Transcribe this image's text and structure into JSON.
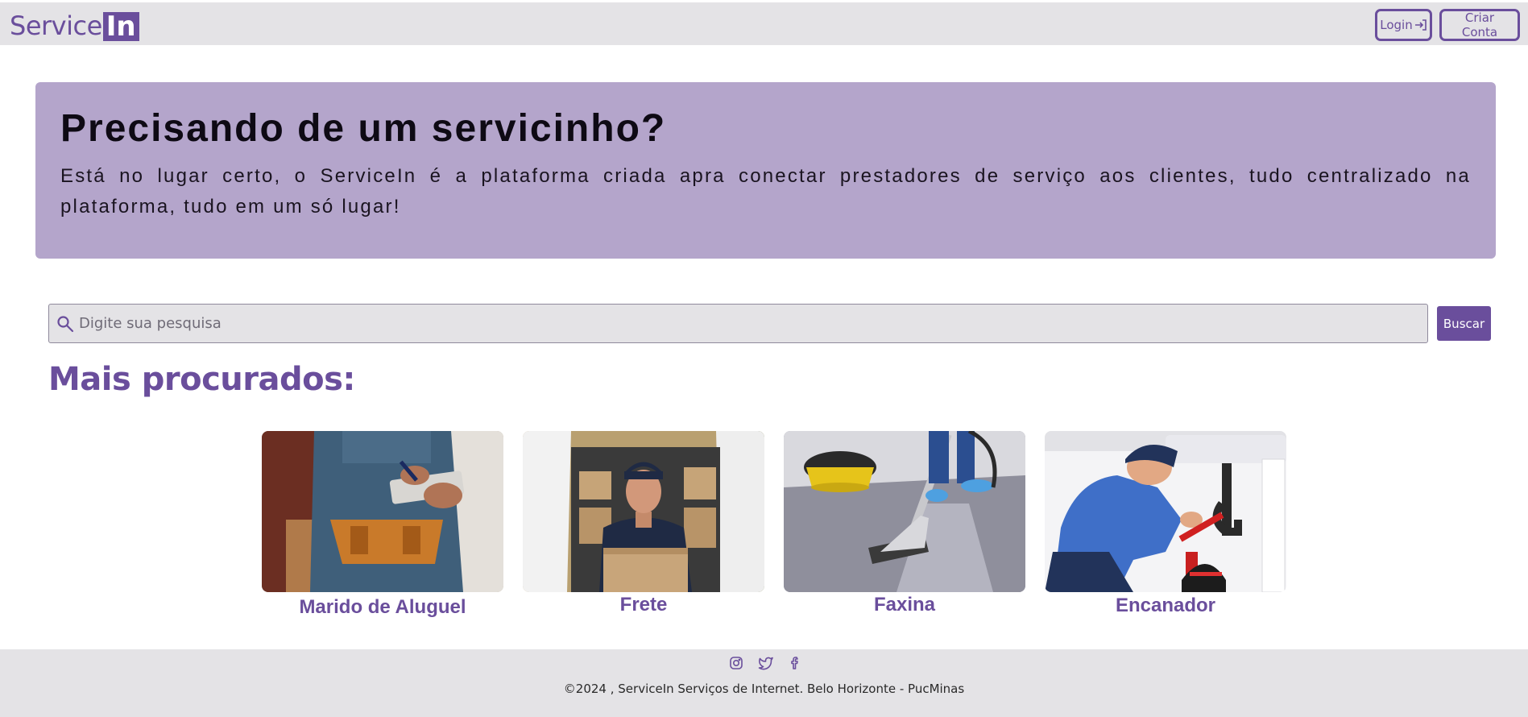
{
  "navbar": {
    "brand_text": "Service",
    "brand_box": "In",
    "login_label": "Login",
    "signup_label": "Criar Conta"
  },
  "hero": {
    "title": "Precisando de um servicinho?",
    "text": "Está no lugar certo, o ServiceIn é a plataforma criada apra conectar prestadores de serviço aos clientes, tudo centralizado na plataforma, tudo em um só lugar!"
  },
  "search": {
    "placeholder": "Digite sua pesquisa",
    "button_label": "Buscar"
  },
  "most_searched": {
    "title": "Mais procurados:",
    "items": [
      {
        "label": "Marido de Aluguel",
        "image": "handyman-photo"
      },
      {
        "label": "Frete",
        "image": "delivery-man-photo"
      },
      {
        "label": "Faxina",
        "image": "carpet-vacuum-photo"
      },
      {
        "label": "Encanador",
        "image": "plumber-photo"
      }
    ]
  },
  "footer": {
    "social_icons": [
      "instagram-icon",
      "twitter-icon",
      "facebook-icon"
    ],
    "copyright": "©2024 , ServiceIn Serviços de Internet. Belo Horizonte - PucMinas"
  },
  "colors": {
    "brand": "#6a4e9c",
    "hero_bg": "#b4a5cb",
    "bar_bg": "#e4e3e6"
  }
}
